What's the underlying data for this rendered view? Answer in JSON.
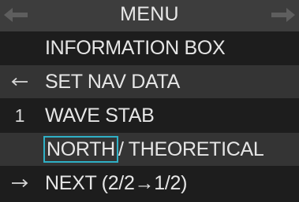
{
  "menu": {
    "title": "MENU",
    "title_left_icon": "left-arrow-icon",
    "title_right_icon": "right-arrow-icon"
  },
  "items": [
    {
      "marker": "",
      "label": "INFORMATION BOX"
    },
    {
      "marker_icon": "left-arrow-icon",
      "label": "SET NAV DATA"
    },
    {
      "marker": "1",
      "label": "WAVE STAB"
    },
    {
      "marker": "",
      "label_selected": "NORTH",
      "label_rest": "/ THEORETICAL"
    },
    {
      "marker_icon": "right-arrow-icon",
      "label": "NEXT (2/2→1/2)"
    }
  ],
  "colors": {
    "background": "#1d1d1d",
    "title_bar": "#3d3d3d",
    "alt_row": "#343434",
    "text": "#e6e6e6",
    "selection_border": "#2fb0c6"
  }
}
